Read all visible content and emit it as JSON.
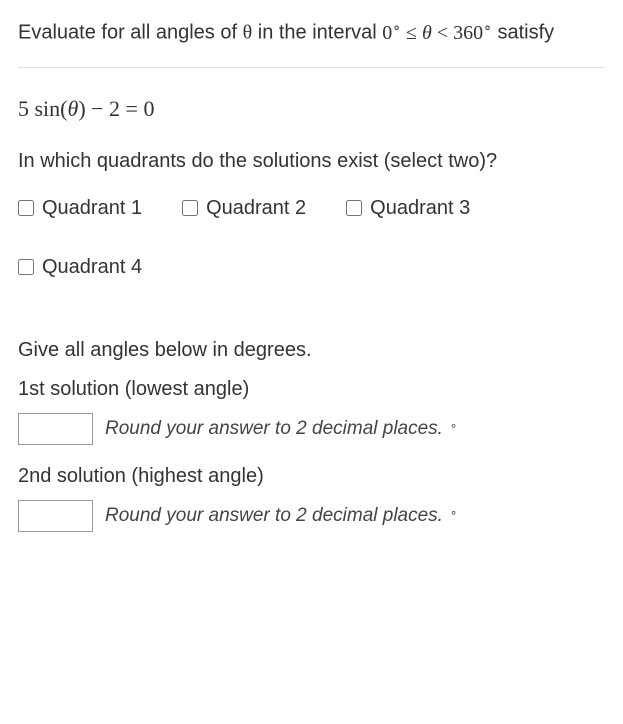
{
  "prompt": {
    "prefix": "Evaluate for all angles of ",
    "theta": "θ",
    "mid": " in the interval ",
    "interval": "0° ≤ θ < 360°",
    "suffix": " satisfy"
  },
  "equation": "5 sin(θ) − 2 = 0",
  "quadrant_question": "In which quadrants do the solutions exist (select two)?",
  "checkboxes": {
    "q1": "Quadrant 1",
    "q2": "Quadrant 2",
    "q3": "Quadrant 3",
    "q4": "Quadrant 4"
  },
  "angles_instruction": "Give all angles below in degrees.",
  "solution1_label": "1st solution (lowest angle)",
  "solution2_label": "2nd solution (highest angle)",
  "rounding_hint": "Round your answer to 2 decimal places.",
  "degree_unit": "°"
}
